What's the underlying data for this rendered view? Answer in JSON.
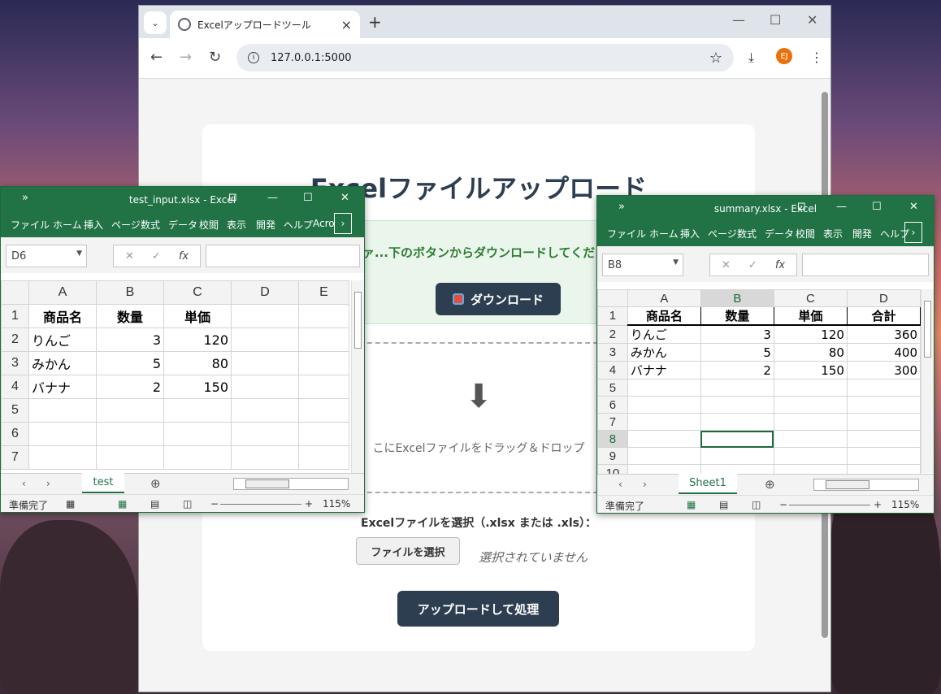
{
  "browser": {
    "tab_title": "Excelアップロードツール",
    "url": "127.0.0.1:5000",
    "avatar": "EJ"
  },
  "page": {
    "heading": "Excelファイルアップロード",
    "success_message": "ァ...下のボタンからダウンロードしてくだ",
    "download_label": "ダウンロード",
    "drop_text": "こにExcelファイルをドラッグ＆ドロップ",
    "select_label": "Excelファイルを選択（.xlsx または .xls）：",
    "file_button": "ファイルを選択",
    "no_file": "選択されていません",
    "upload_button": "アップロードして処理"
  },
  "excel_left": {
    "title": "test_input.xlsx  -  Excel",
    "tabs": [
      "ファイル",
      "ホーム",
      "挿入",
      "ページ",
      "数式",
      "データ",
      "校閲",
      "表示",
      "開発",
      "ヘルプ",
      "Acro"
    ],
    "name_box": "D6",
    "columns": [
      "A",
      "B",
      "C",
      "D",
      "E"
    ],
    "rows": [
      "1",
      "2",
      "3",
      "4",
      "5",
      "6",
      "7"
    ],
    "cells": [
      [
        "商品名",
        "数量",
        "単価",
        "",
        ""
      ],
      [
        "りんご",
        "3",
        "120",
        "",
        ""
      ],
      [
        "みかん",
        "5",
        "80",
        "",
        ""
      ],
      [
        "バナナ",
        "2",
        "150",
        "",
        ""
      ],
      [
        "",
        "",
        "",
        "",
        ""
      ],
      [
        "",
        "",
        "",
        "",
        ""
      ],
      [
        "",
        "",
        "",
        "",
        ""
      ]
    ],
    "sheet": "test",
    "status": "準備完了",
    "zoom": "115%"
  },
  "excel_right": {
    "title": "summary.xlsx  -  Excel",
    "tabs": [
      "ファイル",
      "ホーム",
      "挿入",
      "ページ",
      "数式",
      "データ",
      "校閲",
      "表示",
      "開発",
      "ヘルプ"
    ],
    "name_box": "B8",
    "columns": [
      "A",
      "B",
      "C",
      "D"
    ],
    "rows": [
      "1",
      "2",
      "3",
      "4",
      "5",
      "6",
      "7",
      "8",
      "9",
      "10"
    ],
    "cells": [
      [
        "商品名",
        "数量",
        "単価",
        "合計"
      ],
      [
        "りんご",
        "3",
        "120",
        "360"
      ],
      [
        "みかん",
        "5",
        "80",
        "400"
      ],
      [
        "バナナ",
        "2",
        "150",
        "300"
      ],
      [
        "",
        "",
        "",
        ""
      ],
      [
        "",
        "",
        "",
        ""
      ],
      [
        "",
        "",
        "",
        ""
      ],
      [
        "",
        "",
        "",
        ""
      ],
      [
        "",
        "",
        "",
        ""
      ],
      [
        "",
        "",
        "",
        ""
      ]
    ],
    "sheet": "Sheet1",
    "status": "準備完了",
    "zoom": "115%"
  }
}
